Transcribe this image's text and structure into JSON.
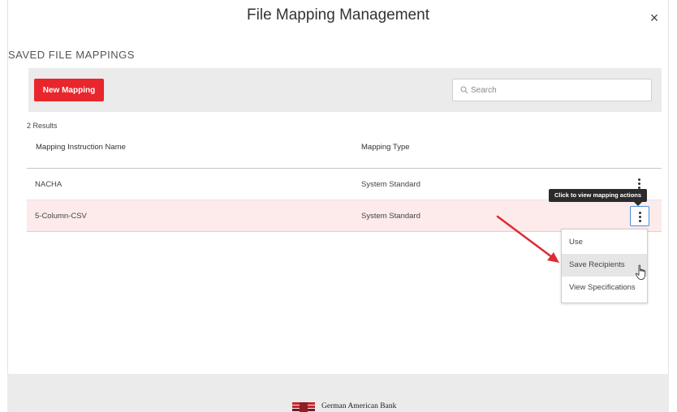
{
  "modal": {
    "title": "File Mapping Management",
    "close_symbol": "×"
  },
  "section": {
    "heading": "SAVED FILE MAPPINGS"
  },
  "toolbar": {
    "new_button_label": "New Mapping",
    "search_placeholder": "Search"
  },
  "table": {
    "results_count": "2 Results",
    "columns": [
      "Mapping Instruction Name",
      "Mapping Type"
    ],
    "rows": [
      {
        "name": "NACHA",
        "type": "System Standard"
      },
      {
        "name": "5-Column-CSV",
        "type": "System Standard"
      }
    ]
  },
  "tooltip": {
    "text": "Click to view mapping actions"
  },
  "action_menu": {
    "items": [
      "Use",
      "Save Recipients",
      "View Specifications"
    ],
    "hovered_index": 1
  },
  "footer": {
    "bank_name": "German American Bank"
  },
  "colors": {
    "accent_red": "#e8262b",
    "selected_row": "#fdeaea",
    "toolbar_bg": "#ebebeb",
    "focus_blue": "#4a90d9"
  }
}
